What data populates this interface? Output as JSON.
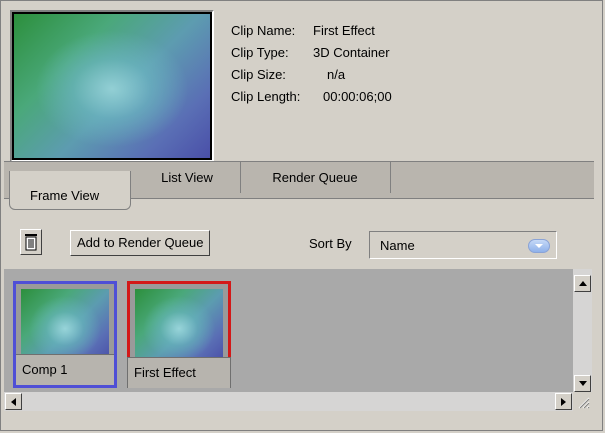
{
  "clip_info": {
    "rows": [
      {
        "key": "Clip Name:",
        "value": "First Effect"
      },
      {
        "key": "Clip Type:",
        "value": "3D Container"
      },
      {
        "key": "Clip Size:",
        "value": "n/a"
      },
      {
        "key": "Clip Length:",
        "value": "00:00:06;00"
      }
    ]
  },
  "tabs": [
    {
      "label": "Frame View",
      "active": true
    },
    {
      "label": "List View",
      "active": false
    },
    {
      "label": "Render Queue",
      "active": false
    }
  ],
  "toolbar": {
    "add_button": "Add to Render Queue",
    "sort_label": "Sort By",
    "sort_value": "Name"
  },
  "thumbnails": [
    {
      "label": "Comp 1",
      "selection_color": "#4f4fd6"
    },
    {
      "label": "First Effect",
      "selection_color": "#d31818"
    }
  ],
  "colors": {
    "window_bg": "#d4d0c8",
    "thumb_area_bg": "#a9a9a9"
  }
}
